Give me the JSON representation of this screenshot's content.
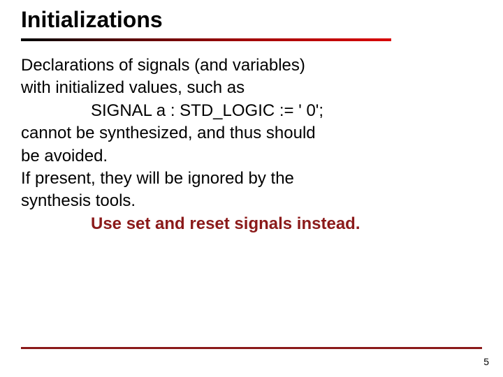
{
  "slide": {
    "title": "Initializations",
    "lines": {
      "l1": "Declarations of signals (and variables)",
      "l2": "with initialized values, such as",
      "l3": "SIGNAL  a : STD_LOGIC := ' 0';",
      "l4": "cannot be synthesized, and thus should",
      "l5": "be avoided.",
      "l6": "If present, they will be ignored by the",
      "l7": "synthesis tools.",
      "l8": "Use set and reset signals instead."
    },
    "page_number": "5"
  }
}
